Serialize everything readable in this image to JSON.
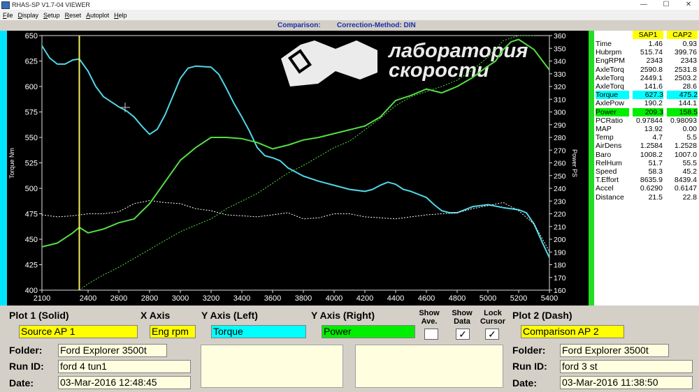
{
  "window": {
    "title": "RHAS-SP V1.7-04  VIEWER",
    "controls": [
      "—",
      "☐",
      "✕"
    ]
  },
  "menu": [
    {
      "u": "F",
      "rest": "ile"
    },
    {
      "u": "D",
      "rest": "isplay"
    },
    {
      "u": "S",
      "rest": "etup"
    },
    {
      "u": "R",
      "rest": "eset"
    },
    {
      "u": "A",
      "rest": "utoplot"
    },
    {
      "u": "H",
      "rest": "elp"
    }
  ],
  "info": {
    "comparison": "Comparison:",
    "correction": "Correction-Method: DIN"
  },
  "watermark": {
    "line1": "лаборатория",
    "line2": "скорости"
  },
  "chart_data": {
    "type": "line",
    "xlabel": "",
    "ylabel_left": "Torque Nm",
    "ylabel_right": "Power PS",
    "xlim": [
      2100,
      5400
    ],
    "ylim_left": [
      400,
      650
    ],
    "ylim_right": [
      160,
      360
    ],
    "x_ticks": [
      2100,
      2400,
      2600,
      2800,
      3000,
      3200,
      3400,
      3600,
      3800,
      4000,
      4200,
      4400,
      4600,
      4800,
      5000,
      5200,
      5400
    ],
    "y_left_ticks": [
      400,
      425,
      450,
      475,
      500,
      525,
      550,
      575,
      600,
      625,
      650
    ],
    "y_right_ticks": [
      160,
      170,
      180,
      190,
      200,
      210,
      220,
      230,
      240,
      250,
      260,
      270,
      280,
      290,
      300,
      310,
      320,
      330,
      340,
      350,
      360
    ],
    "cursor_x": 2343,
    "grid": false,
    "series": [
      {
        "color": "#4fd8e8",
        "axis": "left",
        "style": "solid",
        "x": [
          2100,
          2150,
          2200,
          2250,
          2300,
          2343,
          2400,
          2450,
          2500,
          2550,
          2600,
          2650,
          2700,
          2750,
          2800,
          2850,
          2900,
          2950,
          3000,
          3050,
          3100,
          3200,
          3250,
          3300,
          3350,
          3400,
          3450,
          3500,
          3550,
          3600,
          3650,
          3700,
          3800,
          3900,
          4000,
          4100,
          4200,
          4250,
          4300,
          4350,
          4400,
          4450,
          4500,
          4550,
          4600,
          4650,
          4700,
          4750,
          4800,
          4850,
          4900,
          5000,
          5100,
          5200,
          5250,
          5300,
          5350,
          5400
        ],
        "y": [
          640,
          628,
          622,
          622,
          626,
          627,
          615,
          600,
          590,
          585,
          580,
          576,
          570,
          561,
          553,
          558,
          572,
          590,
          608,
          618,
          620,
          619,
          612,
          598,
          583,
          570,
          556,
          540,
          532,
          530,
          527,
          520,
          512,
          507,
          503,
          499,
          497,
          499,
          503,
          506,
          504,
          499,
          497,
          494,
          491,
          484,
          478,
          476,
          476,
          479,
          482,
          484,
          481,
          479,
          476,
          465,
          448,
          432
        ]
      },
      {
        "color": "#ffffff",
        "axis": "left",
        "style": "dashed",
        "x": [
          2100,
          2200,
          2300,
          2400,
          2500,
          2600,
          2700,
          2800,
          2900,
          3000,
          3100,
          3200,
          3300,
          3400,
          3500,
          3600,
          3700,
          3800,
          3900,
          4000,
          4100,
          4200,
          4300,
          4400,
          4500,
          4600,
          4700,
          4800,
          4900,
          5000,
          5100,
          5200,
          5300,
          5400
        ],
        "y": [
          474,
          472,
          473,
          475,
          475,
          477,
          485,
          488,
          486,
          485,
          480,
          478,
          474,
          473,
          472,
          474,
          476,
          470,
          471,
          475,
          475,
          472,
          471,
          470,
          472,
          474,
          475,
          476,
          480,
          483,
          486,
          478,
          465,
          438
        ]
      },
      {
        "color": "#55dd44",
        "axis": "right",
        "style": "solid",
        "x": [
          2100,
          2200,
          2300,
          2343,
          2400,
          2500,
          2600,
          2700,
          2800,
          2900,
          3000,
          3100,
          3200,
          3300,
          3400,
          3500,
          3600,
          3700,
          3800,
          3900,
          4000,
          4100,
          4200,
          4300,
          4400,
          4500,
          4600,
          4700,
          4800,
          4900,
          5000,
          5050,
          5100,
          5150,
          5200,
          5300,
          5400
        ],
        "y": [
          194,
          197,
          205,
          209.3,
          205,
          208,
          213,
          216,
          228,
          245,
          262,
          272,
          280,
          280,
          279,
          276,
          271,
          274,
          278,
          280,
          283,
          286,
          289,
          296,
          309,
          313,
          318,
          315,
          320,
          327,
          336,
          340,
          349,
          355,
          357,
          349,
          333
        ]
      },
      {
        "color": "#55dd44",
        "axis": "right",
        "style": "dashed",
        "x": [
          2343,
          2400,
          2500,
          2600,
          2700,
          2800,
          2900,
          3000,
          3100,
          3200,
          3300,
          3400,
          3500,
          3600,
          3700,
          3800,
          3900,
          4000,
          4100,
          4200,
          4300,
          4400,
          4500,
          4600,
          4700,
          4800,
          4900,
          5000,
          5100,
          5200,
          5300
        ],
        "y": [
          158.5,
          165,
          172,
          178,
          185,
          192,
          199,
          206,
          211,
          216,
          224,
          230,
          236,
          244,
          252,
          258,
          265,
          272,
          277,
          286,
          295,
          305,
          312,
          316,
          320,
          325,
          333,
          343,
          356,
          360,
          360
        ]
      }
    ]
  },
  "panel": {
    "headers": [
      "SAP1",
      "CAP2"
    ],
    "rows": [
      {
        "label": "Time",
        "v1": "1.46",
        "v2": "0.93"
      },
      {
        "label": "Hubrpm",
        "v1": "515.74",
        "v2": "399.76"
      },
      {
        "label": "EngRPM",
        "v1": "2343",
        "v2": "2343"
      },
      {
        "label": "AxleTorq",
        "v1": "2590.8",
        "v2": "2531.8"
      },
      {
        "label": "AxleTorq",
        "v1": "2449.1",
        "v2": "2503.2"
      },
      {
        "label": "AxleTorq",
        "v1": "141.6",
        "v2": "28.6"
      },
      {
        "label": "Torque",
        "v1": "627.3",
        "v2": "475.2",
        "hl": "#00ffff"
      },
      {
        "label": "AxlePow",
        "v1": "190.2",
        "v2": "144.1"
      },
      {
        "label": "Power",
        "v1": "209.3",
        "v2": "158.5",
        "hl": "#00ee00"
      },
      {
        "label": "PCRatio",
        "v1": "0.97844",
        "v2": "0.98093"
      },
      {
        "label": "MAP",
        "v1": "13.92",
        "v2": "0.00"
      },
      {
        "label": "Temp",
        "v1": "4.7",
        "v2": "5.5"
      },
      {
        "label": "AirDens",
        "v1": "1.2584",
        "v2": "1.2528"
      },
      {
        "label": "Baro",
        "v1": "1008.2",
        "v2": "1007.0"
      },
      {
        "label": "RelHum",
        "v1": "51.7",
        "v2": "55.5"
      },
      {
        "label": "Speed",
        "v1": "58.3",
        "v2": "45.2"
      },
      {
        "label": "T.Effort",
        "v1": "8635.9",
        "v2": "8439.4"
      },
      {
        "label": "Accel",
        "v1": "0.6290",
        "v2": "0.6147"
      },
      {
        "label": "Distance",
        "v1": "21.5",
        "v2": "22.8"
      }
    ]
  },
  "bottom": {
    "plot1_label": "Plot 1 (Solid)",
    "xaxis_label": "X Axis",
    "yleft_label": "Y Axis (Left)",
    "yright_label": "Y Axis (Right)",
    "show_ave_label": "Show Ave.",
    "show_data_label": "Show Data",
    "lock_cursor_label": "Lock Cursor",
    "plot2_label": "Plot 2 (Dash)",
    "plot1_value": "Source AP 1",
    "xaxis_value": "Eng rpm",
    "yleft_value": "Torque",
    "yright_value": "Power",
    "plot2_value": "Comparison AP 2",
    "check_mark": "✓",
    "folder_label": "Folder:",
    "runid_label": "Run ID:",
    "date_label": "Date:",
    "left_folder": "Ford Explorer 3500t",
    "left_runid": "ford 4 tun1",
    "left_date": "03-Mar-2016  12:48:45",
    "right_folder": "Ford Explorer 3500t",
    "right_runid": "ford 3 st",
    "right_date": "03-Mar-2016  11:38:50"
  }
}
